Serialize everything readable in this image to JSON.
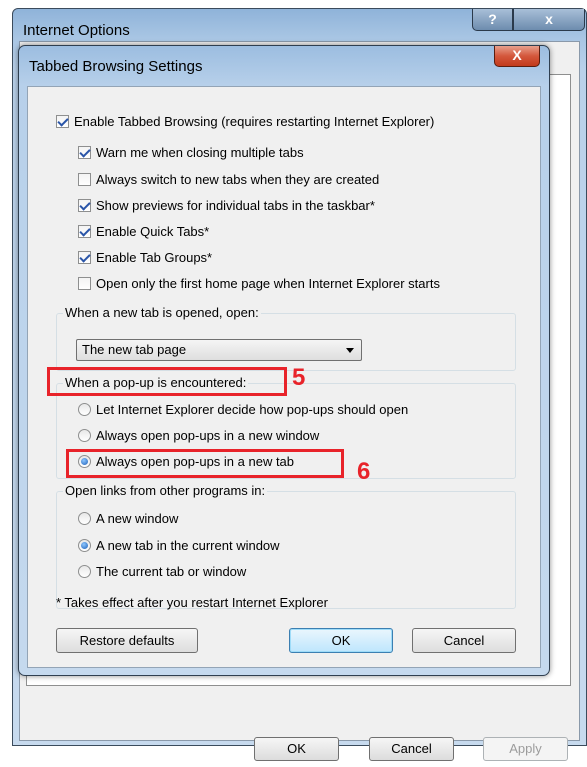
{
  "parent_window": {
    "title": "Internet Options",
    "help_glyph": "?",
    "close_glyph": "x",
    "buttons": {
      "ok": "OK",
      "cancel": "Cancel",
      "apply": "Apply"
    }
  },
  "dialog": {
    "title": "Tabbed Browsing Settings",
    "close_glyph": "X",
    "enable_tabbed": {
      "label": "Enable Tabbed Browsing (requires restarting Internet Explorer)",
      "checked": true
    },
    "options": [
      {
        "label": "Warn me when closing multiple tabs",
        "checked": true
      },
      {
        "label": "Always switch to new tabs when they are created",
        "checked": false
      },
      {
        "label": "Show previews for individual tabs in the taskbar*",
        "checked": true
      },
      {
        "label": "Enable Quick Tabs*",
        "checked": true
      },
      {
        "label": "Enable Tab Groups*",
        "checked": true
      },
      {
        "label": "Open only the first home page when Internet Explorer starts",
        "checked": false
      }
    ],
    "new_tab_group": {
      "label": "When a new tab is opened, open:",
      "selected": "The new tab page"
    },
    "popup_group": {
      "label": "When a pop-up is encountered:",
      "options": [
        {
          "label": "Let Internet Explorer decide how pop-ups should open",
          "selected": false
        },
        {
          "label": "Always open pop-ups in a new window",
          "selected": false
        },
        {
          "label": "Always open pop-ups in a new tab",
          "selected": true
        }
      ]
    },
    "links_group": {
      "label": "Open links from other programs in:",
      "options": [
        {
          "label": "A new window",
          "selected": false
        },
        {
          "label": "A new tab in the current window",
          "selected": true
        },
        {
          "label": "The current tab or window",
          "selected": false
        }
      ]
    },
    "note": "* Takes effect after you restart Internet Explorer",
    "buttons": {
      "restore": "Restore defaults",
      "ok": "OK",
      "cancel": "Cancel"
    }
  },
  "annotations": {
    "marker_5": "5",
    "marker_6": "6",
    "color": "#e8232a"
  }
}
